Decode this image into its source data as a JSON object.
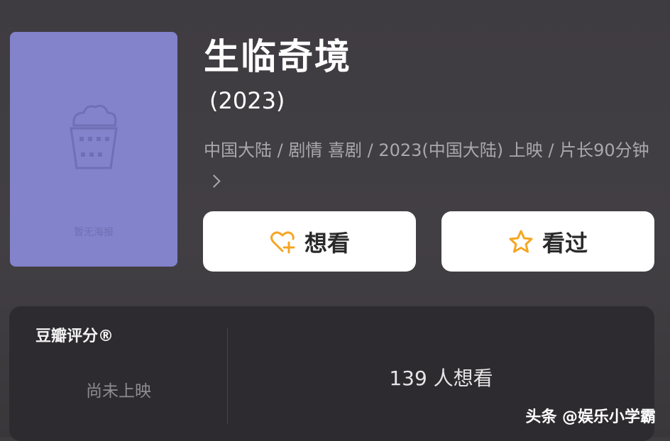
{
  "movie": {
    "title": "生临奇境",
    "year": "(2023)",
    "meta": "中国大陆 / 剧情 喜剧 / 2023(中国大陆) 上映 / 片长90分钟",
    "poster_placeholder": "暂无海报"
  },
  "actions": {
    "want_label": "想看",
    "seen_label": "看过"
  },
  "rating": {
    "title": "豆瓣评分®",
    "status": "尚未上映",
    "want_count": "139 人想看"
  },
  "watermark": "头条 @娱乐小学霸",
  "icons": {
    "poster": "popcorn-icon",
    "want": "heart-plus-icon",
    "seen": "star-icon",
    "meta_more": "chevron-right-icon"
  },
  "colors": {
    "poster_bg": "#8383cc",
    "accent": "#f5a623",
    "card_bg": "#2d2b2f",
    "page_bg": "#403d42"
  }
}
